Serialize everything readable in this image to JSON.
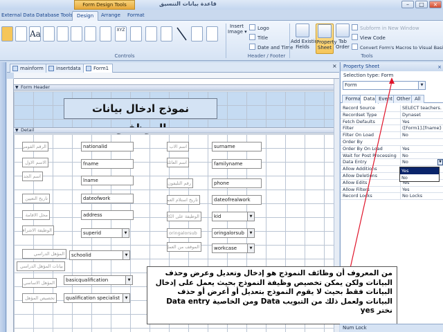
{
  "window": {
    "context_tab": "Form Design Tools",
    "title": "قاعدة بيانات التنسيق"
  },
  "ribbon_tabs": [
    "External Data",
    "Database Tools",
    "Design",
    "Arrange",
    "Format"
  ],
  "ribbon": {
    "controls_group_label": "Controls",
    "insert_image": "Insert\nImage ▾",
    "header_footer": {
      "logo": "Logo",
      "title": "Title",
      "date_time": "Date and Time",
      "label": "Header / Footer"
    },
    "tools": {
      "add_existing_fields": "Add Existing\nFields",
      "property_sheet": "Property\nSheet",
      "tab_order": "Tab\nOrder",
      "subform_new_window": "Subform in New Window",
      "view_code": "View Code",
      "convert_macros": "Convert Form's Macros to Visual Basic",
      "label": "Tools"
    }
  },
  "doc_tabs": [
    "mainform",
    "insertdata",
    "Form1"
  ],
  "design": {
    "form_header_label": "Form Header",
    "detail_label": "Detail",
    "form_title": "نموذج ادخال بيانات الموظفين",
    "controls": [
      {
        "kind": "label",
        "text": "الرقم القومي"
      },
      {
        "kind": "text",
        "text": "nationalid"
      },
      {
        "kind": "label",
        "text": "اسم الاب"
      },
      {
        "kind": "text",
        "text": "surname"
      },
      {
        "kind": "label",
        "text": "الاسم الاول"
      },
      {
        "kind": "text",
        "text": "fname"
      },
      {
        "kind": "label",
        "text": "اسم العائلة"
      },
      {
        "kind": "text",
        "text": "familyname"
      },
      {
        "kind": "label",
        "text": "اسم الجد"
      },
      {
        "kind": "text",
        "text": "lname"
      },
      {
        "kind": "label",
        "text": "رقم التليفون"
      },
      {
        "kind": "text",
        "text": "phone"
      },
      {
        "kind": "label",
        "text": "تاريخ التعيين"
      },
      {
        "kind": "text",
        "text": "dateofwork"
      },
      {
        "kind": "label",
        "text": "تاريخ استلام العمل"
      },
      {
        "kind": "text",
        "text": "dateofrealwork"
      },
      {
        "kind": "label",
        "text": "محل الاقامة"
      },
      {
        "kind": "text",
        "text": "address"
      },
      {
        "kind": "label",
        "text": "الوظيفة على الكادر"
      },
      {
        "kind": "combo",
        "text": "kid"
      },
      {
        "kind": "label",
        "text": "الوظيفة الاشرافية"
      },
      {
        "kind": "combo",
        "text": "superid"
      },
      {
        "kind": "label",
        "text": "oringalorsub"
      },
      {
        "kind": "combo",
        "text": "oringalorsub"
      },
      {
        "kind": "label",
        "text": "الموقف من العمل"
      },
      {
        "kind": "combo",
        "text": "workcase"
      },
      {
        "kind": "label",
        "text": "المؤهل الدراسي"
      },
      {
        "kind": "combo",
        "text": "schoolid"
      },
      {
        "kind": "label",
        "text": "بيانات المؤهل الدراسي"
      },
      {
        "kind": "label",
        "text": "المؤهل الاساسي"
      },
      {
        "kind": "combo",
        "text": "basicqualification"
      },
      {
        "kind": "label",
        "text": "تخصيص المؤهل"
      },
      {
        "kind": "combo",
        "text": "qualification specialist"
      }
    ]
  },
  "property_sheet": {
    "title": "Property Sheet",
    "selection_type": "Selection type:  Form",
    "selected_object": "Form",
    "tabs": [
      "Format",
      "Data",
      "Event",
      "Other",
      "All"
    ],
    "active_tab": "Data",
    "rows": [
      {
        "key": "Record Source",
        "value": "SELECT teachers.nat"
      },
      {
        "key": "Recordset Type",
        "value": "Dynaset"
      },
      {
        "key": "Fetch Defaults",
        "value": "Yes"
      },
      {
        "key": "Filter",
        "value": "([Form1].[fname]=\""
      },
      {
        "key": "Filter On Load",
        "value": "No"
      },
      {
        "key": "Order By",
        "value": ""
      },
      {
        "key": "Order By On Load",
        "value": "Yes"
      },
      {
        "key": "Wait for Post Processing",
        "value": "No"
      },
      {
        "key": "Data Entry",
        "value": "No"
      },
      {
        "key": "Allow Additions",
        "value": ""
      },
      {
        "key": "Allow Deletions",
        "value": ""
      },
      {
        "key": "Allow Edits",
        "value": "Yes"
      },
      {
        "key": "Allow Filters",
        "value": "Yes"
      },
      {
        "key": "Record Locks",
        "value": "No Locks"
      }
    ],
    "dropdown_options": [
      "Yes",
      "No"
    ]
  },
  "annotation": "من المعروف أن وظائف النموذج هو إدخال وتعديل وعرض وحذف البيانات ولكن يمكن تخصيص وظيفة النموذج بحيث يعمل على إدخال البيانات فقط بحيث لا يقوم النموذج بتعديل أو أعرض أو حذف البيانات ولعمل ذلك من التبويب Data ومن الخاصية Data entry نختر yes",
  "status": "Num Lock",
  "colors": {
    "ribbon": "#d6e3f4",
    "accent_active": "#f6c65a",
    "selection_highlight": "#0a246a"
  }
}
